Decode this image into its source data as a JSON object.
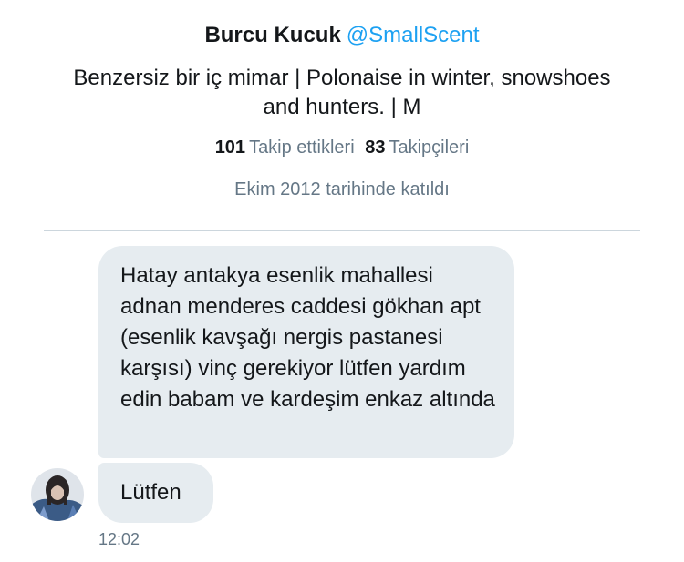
{
  "profile": {
    "name": "Burcu Kucuk",
    "handle": "@SmallScent",
    "bio": "Benzersiz bir iç mimar | Polonaise in winter, snowshoes and hunters. | M",
    "following_count": "101",
    "following_label": "Takip ettikleri",
    "followers_count": "83",
    "followers_label": "Takipçileri",
    "joined": "Ekim 2012 tarihinde katıldı"
  },
  "conversation": {
    "messages": [
      {
        "text": "Hatay antakya esenlik mahallesi adnan menderes caddesi gökhan apt (esenlik kavşağı nergis pastanesi karşısı) vinç gerekiyor lütfen yardım edin babam ve kardeşim enkaz altında"
      },
      {
        "text": "Lütfen"
      }
    ],
    "timestamp": "12:02"
  },
  "colors": {
    "accent": "#1da1f2",
    "bubble": "#e6ecf0",
    "muted": "#657786",
    "divider": "#ccd6dd"
  },
  "icons": {
    "avatar": "avatar"
  }
}
